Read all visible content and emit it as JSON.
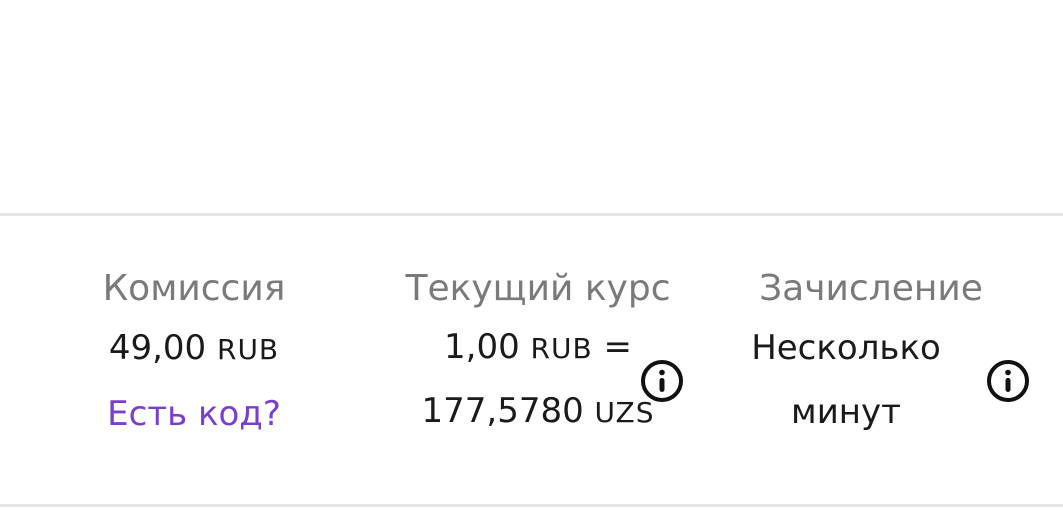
{
  "commission": {
    "label": "Комиссия",
    "amount": "49,00",
    "currency": "RUB",
    "promo_link": "Есть код?"
  },
  "rate": {
    "label": "Текущий курс",
    "from_amount": "1,00",
    "from_currency": "RUB",
    "equals": "=",
    "to_amount": "177,5780",
    "to_currency": "UZS",
    "info_icon": "info-icon"
  },
  "credit": {
    "label": "Зачисление",
    "line1": "Несколько",
    "line2": "минут",
    "info_icon": "info-icon"
  },
  "colors": {
    "label": "#7a7a7a",
    "value": "#1a1a1a",
    "link": "#7b3fd0",
    "divider": "#e6e6e6"
  }
}
